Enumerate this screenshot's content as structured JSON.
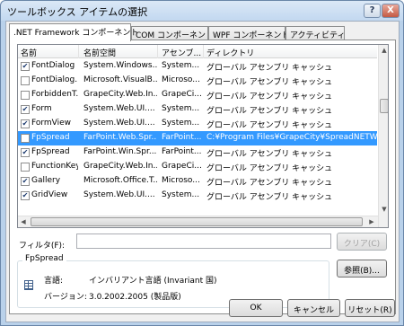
{
  "window": {
    "title": "ツールボックス アイテムの選択",
    "help_label": "?",
    "close_label": "X"
  },
  "tabs": [
    {
      "label": ".NET Framework コンポーネント"
    },
    {
      "label": "COM コンポーネント"
    },
    {
      "label": "WPF コンポーネント"
    },
    {
      "label": "アクティビティ"
    }
  ],
  "grid": {
    "columns": [
      "名前",
      "名前空間",
      "アセンブ...",
      "ディレクトリ"
    ],
    "rows": [
      {
        "checked": "✔",
        "name": "FontDialog",
        "namespace": "System.Windows...",
        "assembly": "System...",
        "directory": "グローバル アセンブリ キャッシュ"
      },
      {
        "checked": "",
        "name": "FontDialog...",
        "namespace": "Microsoft.VisualB...",
        "assembly": "Microso...",
        "directory": "グローバル アセンブリ キャッシュ"
      },
      {
        "checked": "",
        "name": "ForbiddenT...",
        "namespace": "GrapeCity.Web.In...",
        "assembly": "GrapeCi...",
        "directory": "グローバル アセンブリ キャッシュ"
      },
      {
        "checked": "✔",
        "name": "Form",
        "namespace": "System.Web.UI....",
        "assembly": "System...",
        "directory": "グローバル アセンブリ キャッシュ"
      },
      {
        "checked": "✔",
        "name": "FormView",
        "namespace": "System.Web.UI....",
        "assembly": "System...",
        "directory": "グローバル アセンブリ キャッシュ"
      },
      {
        "checked": "",
        "name": "FpSpread",
        "namespace": "FarPoint.Web.Spr...",
        "assembly": "FarPoint...",
        "directory": "C:¥Program Files¥GrapeCity¥SpreadNETWeb3¥..."
      },
      {
        "checked": "✔",
        "name": "FpSpread",
        "namespace": "FarPoint.Win.Spr...",
        "assembly": "FarPoint...",
        "directory": "グローバル アセンブリ キャッシュ"
      },
      {
        "checked": "",
        "name": "FunctionKey",
        "namespace": "GrapeCity.Web.In...",
        "assembly": "GrapeCi...",
        "directory": "グローバル アセンブリ キャッシュ"
      },
      {
        "checked": "✔",
        "name": "Gallery",
        "namespace": "Microsoft.Office.T...",
        "assembly": "Microso...",
        "directory": "グローバル アセンブリ キャッシュ"
      },
      {
        "checked": "✔",
        "name": "GridView",
        "namespace": "System.Web.UI....",
        "assembly": "System...",
        "directory": "グローバル アセンブリ キャッシュ"
      }
    ],
    "scroll_up": "▲",
    "scroll_down": "▼",
    "scroll_left": "◀",
    "scroll_right": "▶"
  },
  "filter": {
    "label": "フィルタ(F):",
    "value": "",
    "clear_label": "クリア(C)"
  },
  "details": {
    "group_title": "FpSpread",
    "language_label": "言語:",
    "language_value": "インバリアント言語 (Invariant 国)",
    "version_label": "バージョン:",
    "version_value": "3.0.2002.2005 (製品版)"
  },
  "buttons": {
    "browse": "参照(B)...",
    "ok": "OK",
    "cancel": "キャンセル",
    "reset": "リセット(R)"
  },
  "colors": {
    "selection": "#3399ff",
    "frame": "#b9d1ea"
  }
}
